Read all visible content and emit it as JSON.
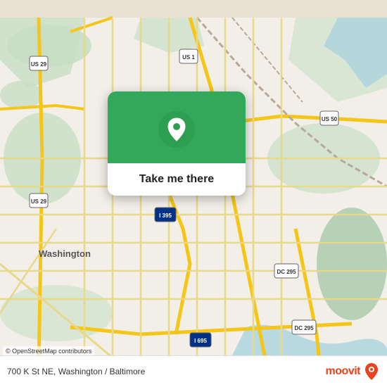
{
  "map": {
    "background_color": "#e8e0d0",
    "osm_attribution": "© OpenStreetMap contributors"
  },
  "popup": {
    "button_label": "Take me there",
    "green_color": "#34a85a"
  },
  "bottom_bar": {
    "address": "700 K St NE, Washington / Baltimore",
    "moovit_label": "moovit"
  },
  "icons": {
    "location_pin": "location-pin-icon",
    "moovit_logo_pin": "moovit-logo-pin-icon"
  }
}
